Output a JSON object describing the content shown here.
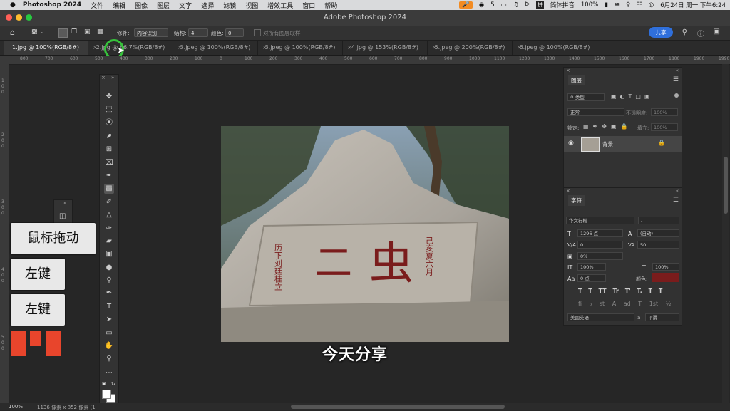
{
  "menubar": {
    "app": "Photoshop 2024",
    "items": [
      "文件",
      "编辑",
      "图像",
      "图层",
      "文字",
      "选择",
      "滤镜",
      "视图",
      "增效工具",
      "窗口",
      "帮助"
    ],
    "notif_count": "5",
    "ime": "简体拼音",
    "battery": "100%",
    "datetime": "6月24日 周一 下午6:24"
  },
  "window": {
    "title": "Adobe Photoshop 2024"
  },
  "options": {
    "mode_label": "修补:",
    "mode_value": "内容识别",
    "structure_label": "结构:",
    "structure_value": "4",
    "color_label": "颜色:",
    "color_value": "0",
    "sample_all_label": "对所有图层取样",
    "share_label": "共享"
  },
  "tabs": [
    {
      "label": "1.jpg @ 100%(RGB/8#)",
      "active": true
    },
    {
      "label": "2.jpg @ 66.7%(RGB/8#)",
      "active": false
    },
    {
      "label": "3.jpeg @ 100%(RGB/8#)",
      "active": false
    },
    {
      "label": "3.jpeg @ 100%(RGB/8#)",
      "active": false
    },
    {
      "label": "4.jpg @ 153%(RGB/8#)",
      "active": false
    },
    {
      "label": "5.jpeg @ 200%(RGB/8#)",
      "active": false
    },
    {
      "label": "6.jpeg @ 100%(RGB/8#)",
      "active": false
    }
  ],
  "ruler_ticks": [
    "800",
    "700",
    "600",
    "500",
    "400",
    "300",
    "200",
    "100",
    "0",
    "100",
    "200",
    "300",
    "400",
    "500",
    "600",
    "700",
    "800",
    "900",
    "1000",
    "1100",
    "1200",
    "1300",
    "1400",
    "1500",
    "1600",
    "1700",
    "1800",
    "1900",
    "1990"
  ],
  "layers_panel": {
    "tab": "图层",
    "kind_filter": "类型",
    "blend_mode": "正常",
    "opacity_label": "不透明度:",
    "opacity": "100%",
    "lock_label": "锁定:",
    "fill_label": "填充:",
    "fill": "100%",
    "layer_name": "背景"
  },
  "char_panel": {
    "tab": "字符",
    "font_family": "华文行楷",
    "font_style": "-",
    "size": "1296 点",
    "leading": "(自动)",
    "kerning": "0",
    "tracking": "50",
    "scale_pct": "0%",
    "vscale": "100%",
    "hscale": "100%",
    "baseline": "0 点",
    "color_label": "颜色:",
    "text_color": "#7a1c1c",
    "language": "美国英语",
    "aa_prefix": "a",
    "antialias": "平滑",
    "style_buttons": [
      "T",
      "T",
      "TT",
      "Tr",
      "T'",
      "T,",
      "T",
      "Ŧ"
    ],
    "ot_buttons": [
      "fi",
      "ℴ",
      "st",
      "A",
      "ad",
      "T",
      "1st",
      "½"
    ]
  },
  "overlay": {
    "cards": [
      "鼠标拖动",
      "左键",
      "左键"
    ],
    "subtitle": "今天分享"
  },
  "status": {
    "zoom": "100%",
    "dims": "1136 像素 x 852 像素 (1"
  },
  "colors": {
    "accent": "#2f6fdb",
    "highlight_ring": "#37c23c",
    "card_red": "#e8452c"
  }
}
